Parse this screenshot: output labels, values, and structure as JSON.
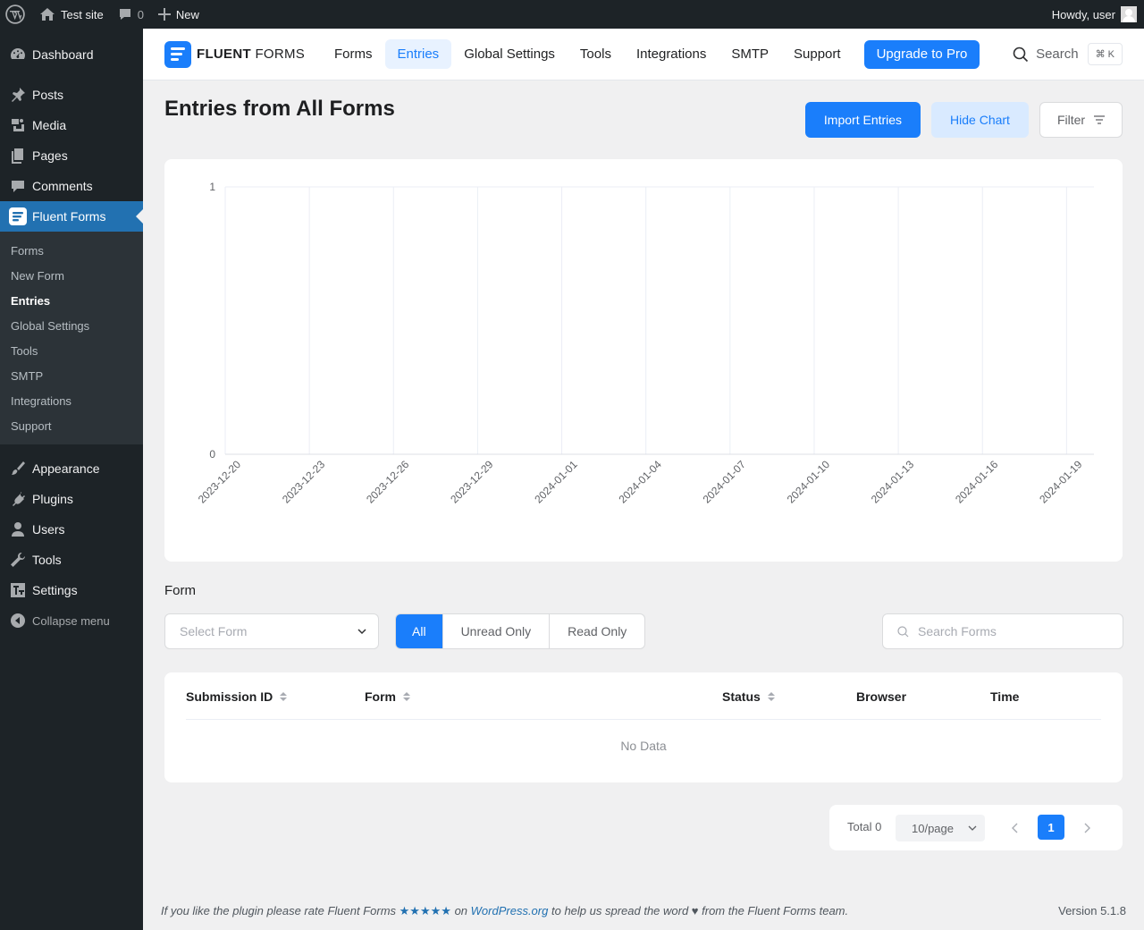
{
  "adminbar": {
    "site_name": "Test site",
    "comments_count": "0",
    "new_label": "New",
    "howdy": "Howdy, user"
  },
  "sidebar": {
    "top_items": [
      {
        "label": "Dashboard",
        "icon": "dashboard-icon"
      }
    ],
    "items": [
      {
        "label": "Posts",
        "icon": "pin-icon"
      },
      {
        "label": "Media",
        "icon": "media-icon"
      },
      {
        "label": "Pages",
        "icon": "pages-icon"
      },
      {
        "label": "Comments",
        "icon": "comment-icon"
      },
      {
        "label": "Fluent Forms",
        "icon": "fluent-forms-icon"
      }
    ],
    "submenu": [
      "Forms",
      "New Form",
      "Entries",
      "Global Settings",
      "Tools",
      "SMTP",
      "Integrations",
      "Support"
    ],
    "bottom_items": [
      {
        "label": "Appearance",
        "icon": "brush-icon"
      },
      {
        "label": "Plugins",
        "icon": "plug-icon"
      },
      {
        "label": "Users",
        "icon": "user-icon"
      },
      {
        "label": "Tools",
        "icon": "wrench-icon"
      },
      {
        "label": "Settings",
        "icon": "settings-icon"
      }
    ],
    "collapse": "Collapse menu"
  },
  "header": {
    "logo_bold": "FLUENT",
    "logo_light": "FORMS",
    "nav": [
      "Forms",
      "Entries",
      "Global Settings",
      "Tools",
      "Integrations",
      "SMTP",
      "Support"
    ],
    "upgrade": "Upgrade to Pro",
    "search": "Search",
    "shortcut": "⌘ K"
  },
  "main": {
    "title": "Entries from All Forms",
    "import_btn": "Import Entries",
    "hide_chart_btn": "Hide Chart",
    "filter_btn": "Filter",
    "form_label": "Form",
    "select_placeholder": "Select Form",
    "segments": [
      "All",
      "Unread Only",
      "Read Only"
    ],
    "search_placeholder": "Search Forms"
  },
  "table": {
    "columns": [
      "Submission ID",
      "Form",
      "Status",
      "Browser",
      "Time"
    ],
    "empty": "No Data"
  },
  "pagination": {
    "total": "Total 0",
    "page_size": "10/page",
    "current_page": "1"
  },
  "footer": {
    "text_before": "If you like the plugin please rate Fluent Forms",
    "stars": "★★★★★",
    "on": "on",
    "link": "WordPress.org",
    "text_after": "to help us spread the word ♥ from the Fluent Forms team.",
    "version": "Version 5.1.8"
  },
  "chart_data": {
    "type": "line",
    "categories": [
      "2023-12-20",
      "2023-12-23",
      "2023-12-26",
      "2023-12-29",
      "2024-01-01",
      "2024-01-04",
      "2024-01-07",
      "2024-01-10",
      "2024-01-13",
      "2024-01-16",
      "2024-01-19"
    ],
    "values": [
      0,
      0,
      0,
      0,
      0,
      0,
      0,
      0,
      0,
      0,
      0
    ],
    "ylim": [
      0,
      1
    ],
    "yticks": [
      "0",
      "1"
    ],
    "title": "",
    "xlabel": "",
    "ylabel": "",
    "grid": true
  },
  "colors": {
    "accent": "#1a7efb",
    "wp_blue": "#2271b1",
    "admin_dark": "#1d2327"
  }
}
